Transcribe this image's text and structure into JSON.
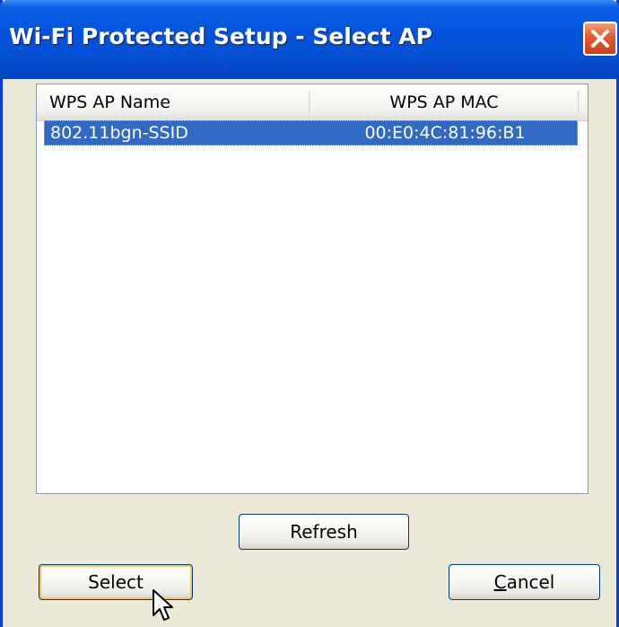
{
  "window": {
    "title": "Wi-Fi Protected Setup - Select AP",
    "close_icon": "close-icon",
    "accent_color": "#0553dc"
  },
  "listview": {
    "columns": [
      "WPS AP Name",
      "WPS AP MAC"
    ],
    "rows": [
      {
        "name": "802.11bgn-SSID",
        "mac": "00:E0:4C:81:96:B1",
        "selected": true
      }
    ],
    "selection_color": "#316ac5"
  },
  "buttons": {
    "refresh": "Refresh",
    "select": "Select",
    "cancel": "Cancel"
  }
}
